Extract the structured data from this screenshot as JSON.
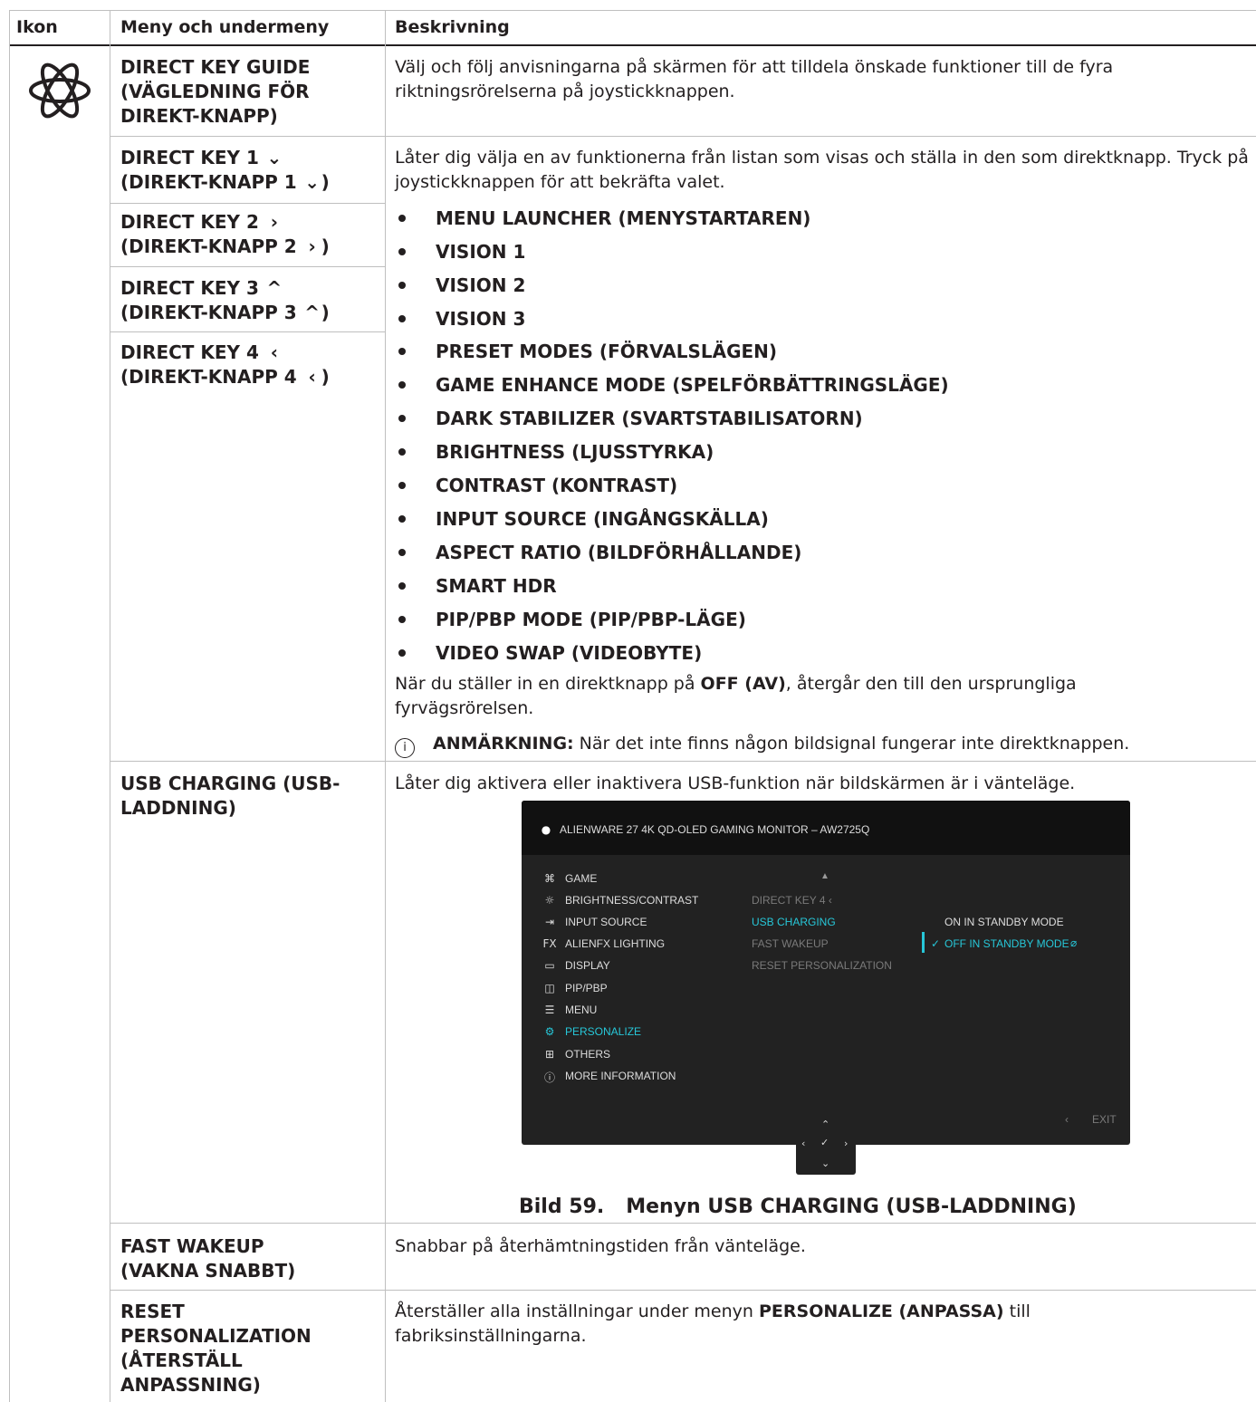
{
  "table": {
    "headers": {
      "icon": "Ikon",
      "menu": "Meny och undermeny",
      "description": "Beskrivning"
    },
    "rows": [
      {
        "menu": "DIRECT KEY GUIDE (VÄGLEDNING FÖR DIREKT-KNAPP)",
        "description": "Välj och följ anvisningarna på skärmen för att tilldela önskade funktioner till de fyra riktningsrörelserna på joystickknappen."
      },
      {
        "menu_line1": "DIRECT KEY 1",
        "menu_line2": "(DIREKT-KNAPP 1",
        "chevron": "⌄",
        "close": ")"
      },
      {
        "menu_line1": "DIRECT KEY 2",
        "menu_line2": "(DIREKT-KNAPP 2",
        "chevron": "›",
        "close": ")"
      },
      {
        "menu_line1": "DIRECT KEY 3",
        "menu_line2": "(DIREKT-KNAPP 3",
        "chevron": "^",
        "close": ")"
      },
      {
        "menu_line1": "DIRECT KEY 4",
        "menu_line2": "(DIREKT-KNAPP 4",
        "chevron": "‹",
        "close": ")"
      }
    ],
    "direct_key_intro": "Låter dig välja en av funktionerna från listan som visas och ställa in den som direktknapp. Tryck på joystickknappen för att bekräfta valet.",
    "options": [
      "MENU LAUNCHER (MENYSTARTAREN)",
      "VISION 1",
      "VISION 2",
      "VISION 3",
      "PRESET MODES (FÖRVALSLÄGEN)",
      "GAME ENHANCE MODE (SPELFÖRBÄTTRINGSLÄGE)",
      "DARK STABILIZER (SVARTSTABILISATORN)",
      "BRIGHTNESS (LJUSSTYRKA)",
      "CONTRAST (KONTRAST)",
      "INPUT SOURCE (INGÅNGSKÄLLA)",
      "ASPECT RATIO (BILDFÖRHÅLLANDE)",
      "SMART HDR",
      "PIP/PBP MODE (PIP/PBP-LÄGE)",
      "VIDEO SWAP (VIDEOBYTE)"
    ],
    "off_text_before": "När du ställer in en direktknapp på ",
    "off_text_bold": "OFF (AV)",
    "off_text_after": ", återgår den till den ursprungliga fyrvägsrörelsen.",
    "note_label": "ANMÄRKNING:",
    "note_text": " När det inte finns någon bildsignal fungerar inte direktknappen.",
    "usb": {
      "menu": "USB CHARGING (USB-LADDNING)",
      "description": "Låter dig aktivera eller inaktivera USB-funktion när bildskärmen är i vänteläge."
    },
    "fast_wakeup": {
      "menu": "FAST WAKEUP (VAKNA SNABBT)",
      "description": "Snabbar på återhämtningstiden från vänteläge."
    },
    "reset": {
      "menu": "RESET PERSONALIZATION (ÅTERSTÄLL ANPASSNING)",
      "desc_before": "Återställer alla inställningar under menyn ",
      "desc_bold": "PERSONALIZE (ANPASSA)",
      "desc_after": " till fabriksinställningarna."
    }
  },
  "figure": {
    "caption_num": "Bild 59.",
    "caption_text": "Menyn USB CHARGING (USB-LADDNING)"
  },
  "osd": {
    "title": "ALIENWARE 27 4K QD-OLED GAMING MONITOR – AW2725Q",
    "main_menu": [
      {
        "icon": "gamepad-icon",
        "glyph": "⌘",
        "label": "GAME"
      },
      {
        "icon": "brightness-icon",
        "glyph": "☼",
        "label": "BRIGHTNESS/CONTRAST"
      },
      {
        "icon": "input-icon",
        "glyph": "⇥",
        "label": "INPUT SOURCE"
      },
      {
        "icon": "fx-icon",
        "glyph": "FX",
        "label": "ALIENFX LIGHTING"
      },
      {
        "icon": "display-icon",
        "glyph": "▭",
        "label": "DISPLAY"
      },
      {
        "icon": "pip-icon",
        "glyph": "◫",
        "label": "PIP/PBP"
      },
      {
        "icon": "menu-icon",
        "glyph": "☰",
        "label": "MENU"
      },
      {
        "icon": "personalize-icon",
        "glyph": "⚙",
        "label": "PERSONALIZE",
        "active": true
      },
      {
        "icon": "others-icon",
        "glyph": "⊞",
        "label": "OTHERS"
      },
      {
        "icon": "info-icon",
        "glyph": "ⓘ",
        "label": "MORE INFORMATION"
      }
    ],
    "sub_menu": [
      "DIRECT KEY 4 ‹",
      "USB CHARGING",
      "FAST WAKEUP",
      "RESET PERSONALIZATION"
    ],
    "options": [
      "ON IN STANDBY MODE",
      "OFF IN STANDBY MODE"
    ],
    "exit": "EXIT",
    "colors": {
      "accent": "#27c7d8",
      "panel": "#222222",
      "header": "#111111"
    }
  }
}
